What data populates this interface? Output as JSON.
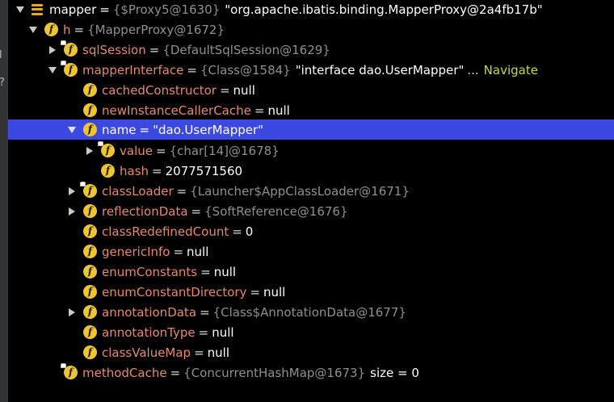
{
  "left_strip": {
    "glyphs": [
      "l",
      "?"
    ]
  },
  "root": {
    "name": "mapper",
    "eq": "=",
    "type_ref": "{$Proxy5@1630}",
    "string_value": "\"org.apache.ibatis.binding.MapperProxy@2a4fb17b\""
  },
  "h": {
    "name": "h",
    "eq": "=",
    "type_ref": "{MapperProxy@1672}"
  },
  "sqlSession": {
    "name": "sqlSession",
    "eq": "=",
    "type_ref": "{DefaultSqlSession@1629}"
  },
  "mapperInterface": {
    "name": "mapperInterface",
    "eq": "=",
    "type_ref": "{Class@1584}",
    "string_value": "\"interface dao.UserMapper\"",
    "ellipsis": "...",
    "navigate": "Navigate"
  },
  "cachedConstructor": {
    "name": "cachedConstructor",
    "eq": "=",
    "value": "null"
  },
  "newInstanceCallerCache": {
    "name": "newInstanceCallerCache",
    "eq": "=",
    "value": "null"
  },
  "name_field": {
    "name": "name",
    "eq": "=",
    "string_value": "\"dao.UserMapper\""
  },
  "value_field": {
    "name": "value",
    "eq": "=",
    "type_ref": "{char[14]@1678}"
  },
  "hash_field": {
    "name": "hash",
    "eq": "=",
    "value": "2077571560"
  },
  "classLoader": {
    "name": "classLoader",
    "eq": "=",
    "type_ref": "{Launcher$AppClassLoader@1671}"
  },
  "reflectionData": {
    "name": "reflectionData",
    "eq": "=",
    "type_ref": "{SoftReference@1676}"
  },
  "classRedefinedCount": {
    "name": "classRedefinedCount",
    "eq": "=",
    "value": "0"
  },
  "genericInfo": {
    "name": "genericInfo",
    "eq": "=",
    "value": "null"
  },
  "enumConstants": {
    "name": "enumConstants",
    "eq": "=",
    "value": "null"
  },
  "enumConstantDirectory": {
    "name": "enumConstantDirectory",
    "eq": "=",
    "value": "null"
  },
  "annotationData": {
    "name": "annotationData",
    "eq": "=",
    "type_ref": "{Class$AnnotationData@1677}"
  },
  "annotationType": {
    "name": "annotationType",
    "eq": "=",
    "value": "null"
  },
  "classValueMap": {
    "name": "classValueMap",
    "eq": "=",
    "value": "null"
  },
  "methodCache": {
    "name": "methodCache",
    "eq": "=",
    "type_ref": "{ConcurrentHashMap@1673}",
    "size_text": "size = 0"
  },
  "icons": {
    "field": "f",
    "expand": "chevron-down",
    "collapse": "chevron-right",
    "root": "stack-icon"
  },
  "colors": {
    "background": "#000000",
    "selection": "#3b49e0",
    "field_name": "#e6896b",
    "type_ref": "#8f8f8f",
    "navigate": "#c4d93f",
    "field_icon": "#f0c52f"
  }
}
